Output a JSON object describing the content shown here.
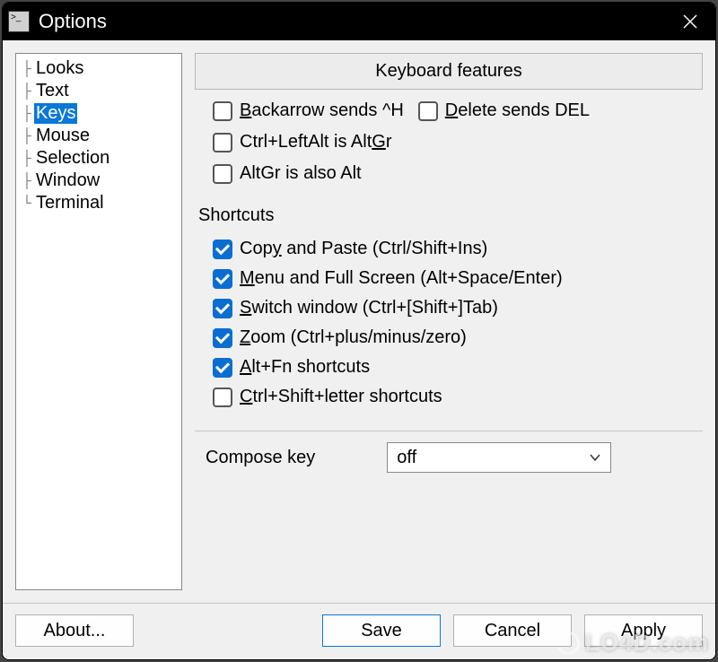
{
  "window": {
    "title": "Options"
  },
  "sidebar": {
    "items": [
      {
        "label": "Looks",
        "selected": false
      },
      {
        "label": "Text",
        "selected": false
      },
      {
        "label": "Keys",
        "selected": true
      },
      {
        "label": "Mouse",
        "selected": false
      },
      {
        "label": "Selection",
        "selected": false
      },
      {
        "label": "Window",
        "selected": false
      },
      {
        "label": "Terminal",
        "selected": false
      }
    ]
  },
  "panel": {
    "group_title": "Keyboard features",
    "checks_top": [
      {
        "label_pre": "",
        "underline": "B",
        "label_post": "ackarrow sends ^H",
        "checked": false
      },
      {
        "label_pre": "",
        "underline": "D",
        "label_post": "elete sends DEL",
        "checked": false
      },
      {
        "label_pre": "Ctrl+LeftAlt is Alt",
        "underline": "G",
        "label_post": "r",
        "checked": false
      },
      {
        "label_pre": "AltGr is also Alt",
        "underline": "",
        "label_post": "",
        "checked": false
      }
    ],
    "shortcuts_label": "Shortcuts",
    "shortcuts": [
      {
        "label_pre": "Cop",
        "underline": "y",
        "label_post": " and Paste (Ctrl/Shift+Ins)",
        "checked": true
      },
      {
        "label_pre": "",
        "underline": "M",
        "label_post": "enu and Full Screen (Alt+Space/Enter)",
        "checked": true
      },
      {
        "label_pre": "",
        "underline": "S",
        "label_post": "witch window (Ctrl+[Shift+]Tab)",
        "checked": true
      },
      {
        "label_pre": "",
        "underline": "Z",
        "label_post": "oom (Ctrl+plus/minus/zero)",
        "checked": true
      },
      {
        "label_pre": "",
        "underline": "A",
        "label_post": "lt+Fn shortcuts",
        "checked": true
      },
      {
        "label_pre": "",
        "underline": "C",
        "label_post": "trl+Shift+letter shortcuts",
        "checked": false
      }
    ],
    "compose_label": "Compose key",
    "compose_value": "off"
  },
  "footer": {
    "about": "About...",
    "save": "Save",
    "cancel": "Cancel",
    "apply": "Apply"
  },
  "watermark": "LO4D.com"
}
